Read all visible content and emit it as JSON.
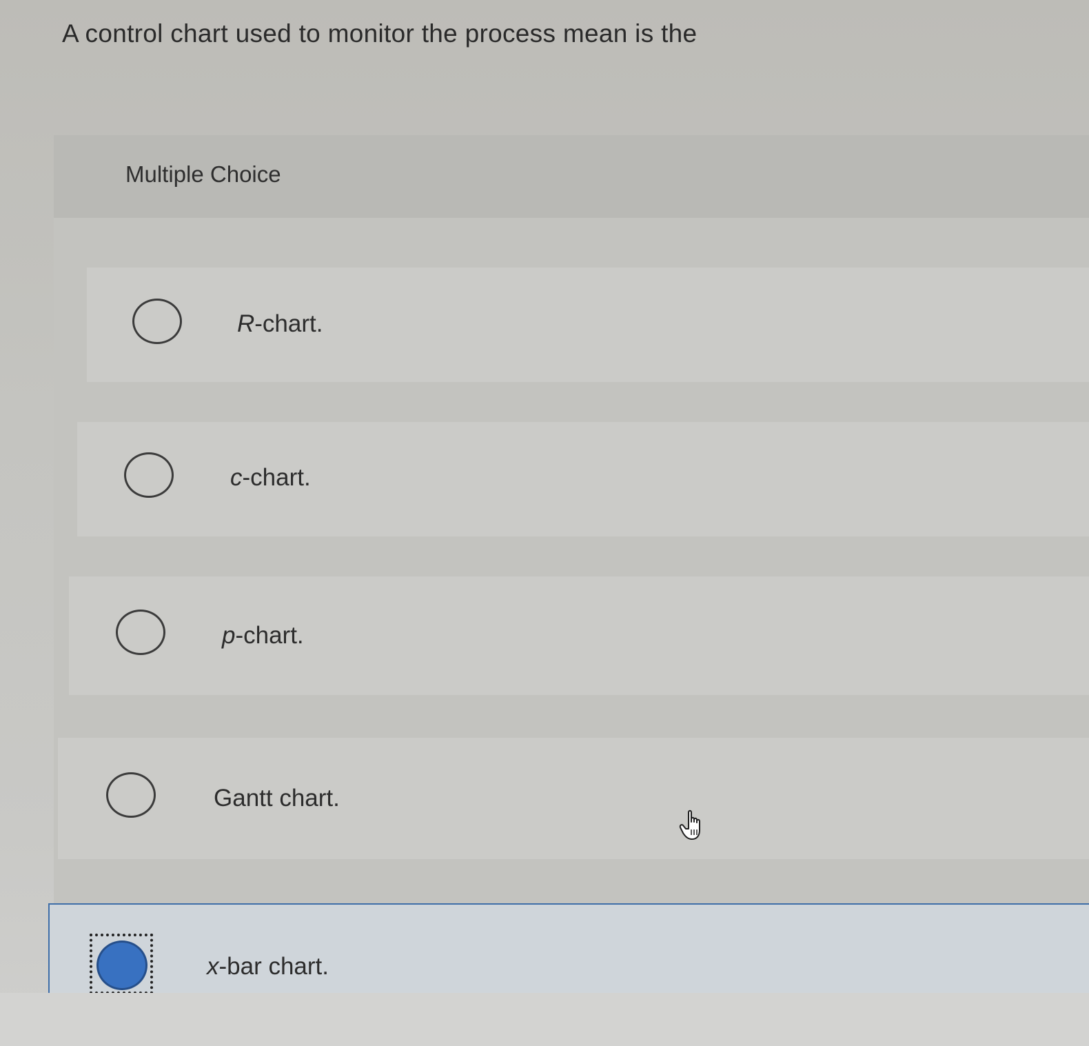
{
  "question": {
    "text": "A control chart used to monitor the process mean is the"
  },
  "multiple_choice": {
    "label": "Multiple Choice",
    "options": [
      {
        "prefix": "R",
        "suffix": "-chart.",
        "selected": false
      },
      {
        "prefix": "c",
        "suffix": "-chart.",
        "selected": false
      },
      {
        "prefix": "p",
        "suffix": "-chart.",
        "selected": false
      },
      {
        "prefix": "",
        "suffix": "Gantt chart.",
        "selected": false
      },
      {
        "prefix": "x",
        "suffix": "-bar chart.",
        "selected": true
      }
    ]
  },
  "colors": {
    "selected_radio": "#3871c1",
    "selected_border": "#3f6ea8"
  },
  "icons": {
    "cursor": "hand-pointer-icon"
  }
}
